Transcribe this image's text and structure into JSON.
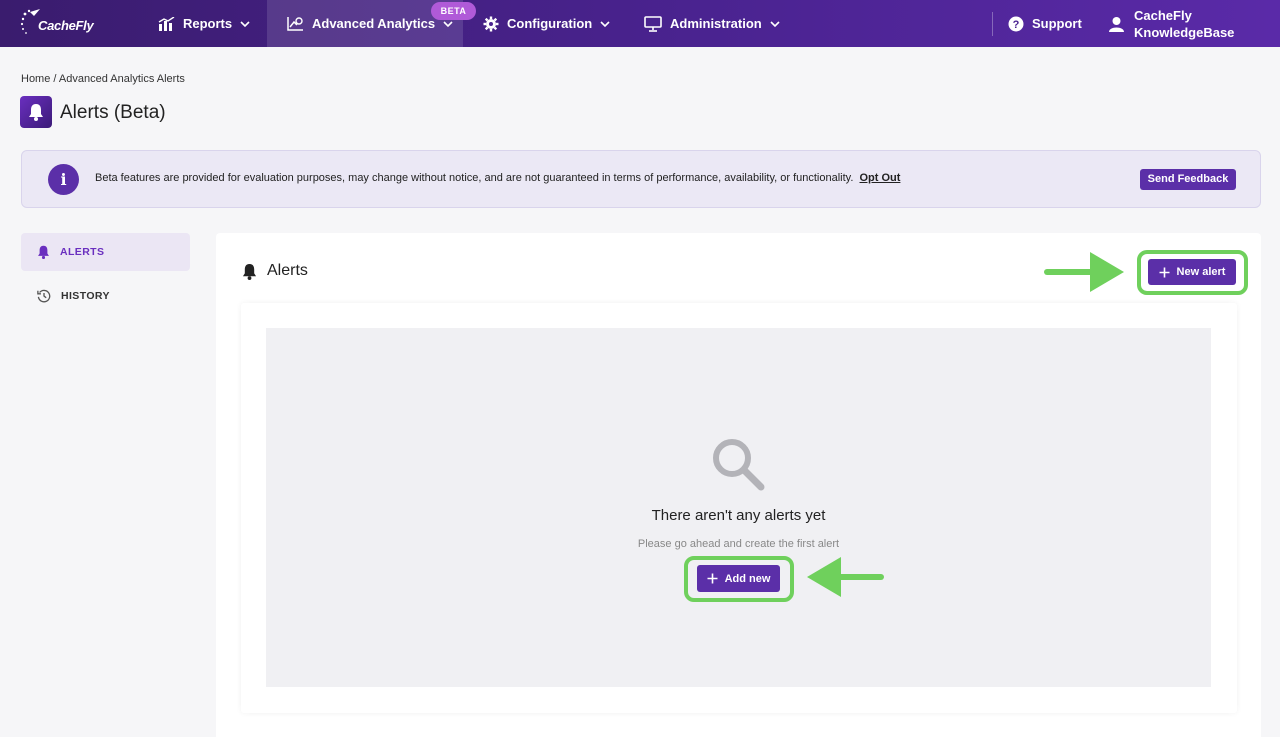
{
  "nav": {
    "logo_text": "CacheFly",
    "items": [
      {
        "label": "Reports",
        "icon": "bar-chart-icon"
      },
      {
        "label": "Advanced Analytics",
        "icon": "analytics-icon",
        "badge": "BETA"
      },
      {
        "label": "Configuration",
        "icon": "gear-icon"
      },
      {
        "label": "Administration",
        "icon": "monitor-icon"
      }
    ],
    "support_label": "Support",
    "user_line1": "CacheFly",
    "user_line2": "KnowledgeBase"
  },
  "breadcrumb": {
    "home": "Home",
    "separator": "/",
    "current": "Advanced Analytics Alerts"
  },
  "page": {
    "title": "Alerts (Beta)"
  },
  "banner": {
    "icon_glyph": "i",
    "text": "Beta features are provided for evaluation purposes, may change without notice, and are not guaranteed in terms of performance, availability, or functionality.",
    "opt_out": "Opt Out",
    "feedback_label": "Send Feedback"
  },
  "sidebar": {
    "items": [
      {
        "label": "ALERTS",
        "icon": "bell-icon",
        "active": true
      },
      {
        "label": "HISTORY",
        "icon": "history-icon",
        "active": false
      }
    ]
  },
  "main": {
    "title": "Alerts",
    "new_alert_label": "New alert",
    "empty_title": "There aren't any alerts yet",
    "empty_subtitle": "Please go ahead and create the first alert",
    "add_new_label": "Add new"
  },
  "colors": {
    "primary": "#5b2fa8",
    "highlight": "#6fd05c",
    "nav_bg": "#3a1c6e"
  }
}
